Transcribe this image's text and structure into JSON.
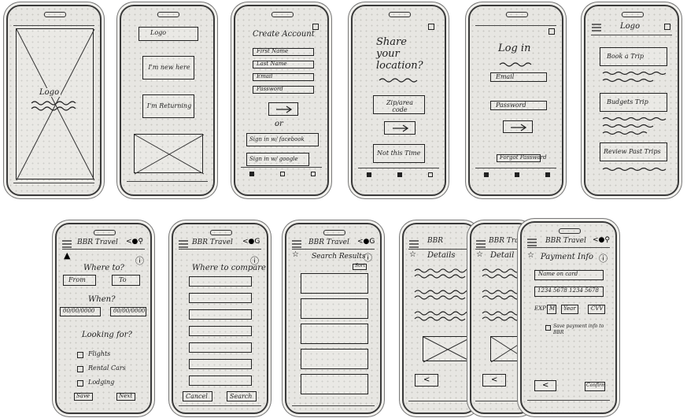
{
  "s1": {
    "logo": "Logo"
  },
  "s2": {
    "logo": "Logo",
    "new_here": "I'm new here",
    "returning": "I'm Returning"
  },
  "s3": {
    "title": "Create Account",
    "fields": [
      "First Name",
      "Last Name",
      "Email",
      "Password"
    ],
    "or": "or",
    "facebook": "Sign in w/ facebook",
    "google": "Sign in w/ google"
  },
  "s4": {
    "title": "Share your location?",
    "zip": "Zip/area code",
    "not_this_time": "Not this Time"
  },
  "s5": {
    "title": "Log in",
    "email": "Email",
    "password": "Password",
    "forgot": "Forgot Password"
  },
  "s6": {
    "logo": "Logo",
    "book": "Book a Trip",
    "budget": "Budgets Trip",
    "review": "Review Past Trips"
  },
  "s7": {
    "brand": "BBR Travel",
    "where": "Where to?",
    "from": "From",
    "to": "To",
    "when": "When?",
    "date_from": "00/00/0000",
    "date_to": "00/00/0000",
    "looking": "Looking for?",
    "options": [
      "Flights",
      "Rental Cars",
      "Lodging"
    ],
    "save": "Save",
    "next": "Next"
  },
  "s8": {
    "brand": "BBR Travel",
    "title": "Where to compare?",
    "cancel": "Cancel",
    "search": "Search"
  },
  "s9": {
    "brand": "BBR Travel",
    "title": "Search Results",
    "badge": "Sort"
  },
  "s10": {
    "brand": "BBR",
    "title": "Details"
  },
  "s11": {
    "brand": "BBR Tra",
    "title": "Detail"
  },
  "s12": {
    "brand": "BBR Travel",
    "title": "Payment Info",
    "name": "Name on card",
    "card": "1234 5678 1234 5678",
    "exp_label": "EXP",
    "exp_m": "M",
    "exp_y": "Year",
    "cvv": "CVV",
    "save_note": "Save payment info to BBR",
    "confirm": "Confirm"
  }
}
